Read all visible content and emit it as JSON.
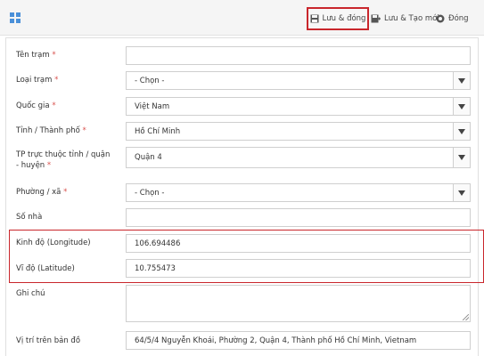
{
  "toolbar": {
    "save_close_label": "Lưu & đóng",
    "save_new_label": "Lưu & Tạo mới",
    "close_label": "Đóng"
  },
  "form": {
    "station_name": {
      "label": "Tên trạm",
      "value": ""
    },
    "station_type": {
      "label": "Loại trạm",
      "value": "- Chọn -"
    },
    "country": {
      "label": "Quốc gia",
      "value": "Việt Nam"
    },
    "province": {
      "label": "Tỉnh / Thành phố",
      "value": "Hồ Chí Minh"
    },
    "district": {
      "label": "TP trực thuộc tỉnh / quận - huyện",
      "value": "Quận 4"
    },
    "ward": {
      "label": "Phường / xã",
      "value": "- Chọn -"
    },
    "house_number": {
      "label": "Số nhà",
      "value": ""
    },
    "longitude": {
      "label": "Kinh độ (Longitude)",
      "value": "106.694486"
    },
    "latitude": {
      "label": "Vĩ độ (Latitude)",
      "value": "10.755473"
    },
    "note": {
      "label": "Ghi chú",
      "value": ""
    },
    "map_location": {
      "label": "Vị trí trên bản đồ",
      "value": "64/5/4 Nguyễn Khoái, Phường 2, Quận 4, Thành phố Hồ Chí Minh, Vietnam"
    }
  },
  "required_marker": "*",
  "colors": {
    "accent_red": "#c9262c",
    "icon_blue": "#4a90d9",
    "required": "#d9534f"
  }
}
